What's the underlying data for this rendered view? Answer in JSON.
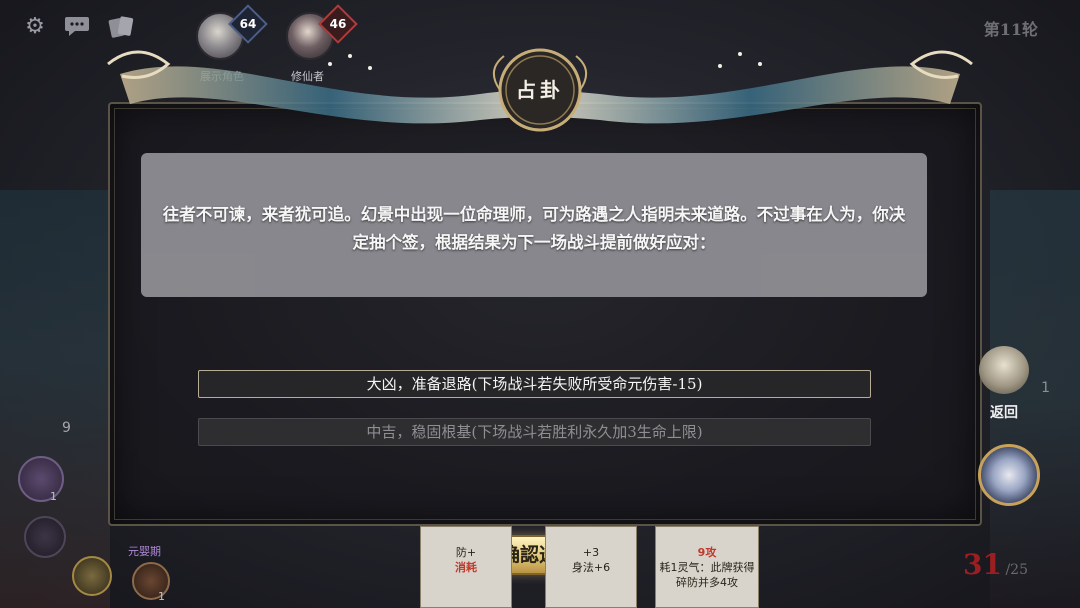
{
  "hud": {
    "settings_icon": "gear-icon",
    "chat_icon": "chat-bubble-icon",
    "cards_icon": "cards-icon",
    "player1": {
      "level": "64",
      "label": "展示角色"
    },
    "player2": {
      "level": "46",
      "label": "修仙者"
    },
    "round": "第11轮"
  },
  "event": {
    "title": "占卦",
    "description": "往者不可谏，来者犹可追。幻景中出现一位命理师，可为路遇之人指明未来道路。不过事在人为，你决定抽个签，根据结果为下一场战斗提前做好应对：",
    "options": [
      {
        "label": "大凶，准备退路(下场战斗若失败所受命元伤害-15)",
        "enabled": true
      },
      {
        "label": "中吉，稳固根基(下场战斗若胜利永久加3生命上限)",
        "enabled": false
      }
    ],
    "confirm_label": "确認选择"
  },
  "side": {
    "back_label": "返回",
    "deck_count": "1",
    "left_count": "9",
    "left_small_count_1": "1",
    "left_small_count_2": "1",
    "tag_label": "元婴期"
  },
  "cards": [
    {
      "line1": "防+",
      "line2": "消耗"
    },
    {
      "line1": "+3",
      "line2": "身法+6"
    },
    {
      "line1": "9攻",
      "line2": "耗1灵气：此牌获得碎防并多4攻"
    }
  ],
  "hp": {
    "current": "31",
    "max": "/25"
  },
  "colors": {
    "accent_gold": "#e5cc7d",
    "hp_red": "#9b1e22",
    "panel_gray": "#8d8c92"
  }
}
